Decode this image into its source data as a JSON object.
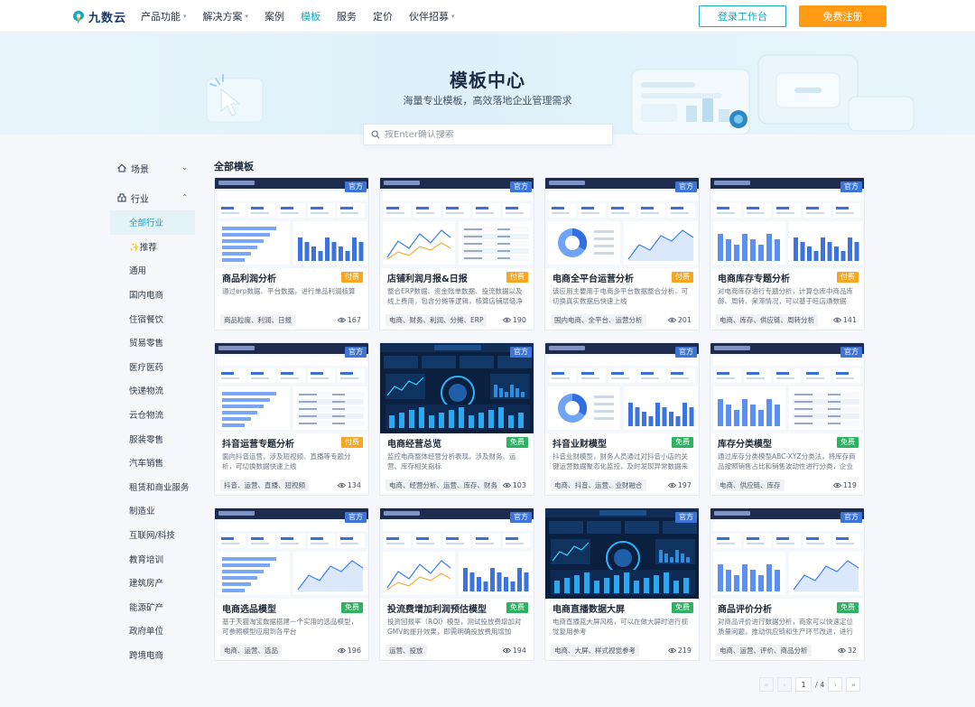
{
  "header": {
    "logo_text": "九数云",
    "nav": [
      {
        "label": "产品功能",
        "dropdown": true,
        "active": false
      },
      {
        "label": "解决方案",
        "dropdown": true,
        "active": false
      },
      {
        "label": "案例",
        "dropdown": false,
        "active": false
      },
      {
        "label": "模板",
        "dropdown": false,
        "active": true
      },
      {
        "label": "服务",
        "dropdown": false,
        "active": false
      },
      {
        "label": "定价",
        "dropdown": false,
        "active": false
      },
      {
        "label": "伙伴招募",
        "dropdown": true,
        "active": false
      }
    ],
    "login_label": "登录工作台",
    "register_label": "免费注册"
  },
  "hero": {
    "title": "模板中心",
    "subtitle": "海量专业模板，高效落地企业管理需求"
  },
  "search": {
    "placeholder": "按Enter确认搜索"
  },
  "sidebar": {
    "groups": [
      {
        "label": "场景",
        "expanded": false
      },
      {
        "label": "行业",
        "expanded": true
      }
    ],
    "items": [
      "全部行业",
      "✨推荐",
      "通用",
      "国内电商",
      "住宿餐饮",
      "贸易零售",
      "医疗医药",
      "快递物流",
      "云仓物流",
      "服装零售",
      "汽车销售",
      "租赁和商业服务",
      "制造业",
      "互联网/科技",
      "教育培训",
      "建筑房产",
      "能源矿产",
      "政府单位",
      "跨境电商"
    ],
    "active_index": 0
  },
  "main": {
    "section_title": "全部模板",
    "official_badge": "官方",
    "cards": [
      {
        "title": "商品利润分析",
        "price": "付费",
        "type": "paid",
        "desc": "通过erp数据、平台数据，进行单品利润核算",
        "tags": "商品粒度、利润、日报",
        "count": "167",
        "theme": "light"
      },
      {
        "title": "店铺利润月报&日报",
        "price": "付费",
        "type": "paid",
        "desc": "整合ERP数据、资金账单数据、投流数据以及线上费用，包含分摊等逻辑，核算店铺层级净利…",
        "tags": "电商、财务、利润、分摊、ERP",
        "count": "190",
        "theme": "light"
      },
      {
        "title": "电商全平台运营分析",
        "price": "付费",
        "type": "paid",
        "desc": "该应用主要用于电商多平台数据整合分析，可切换真实数据后快速上线",
        "tags": "国内电商、全平台、运营分析",
        "count": "201",
        "theme": "light"
      },
      {
        "title": "电商库存专题分析",
        "price": "付费",
        "type": "paid",
        "desc": "对电商库存进行专题分析，计算仓库中商品库龄、周转、呆滞情况，可以基于旺店通数据快…",
        "tags": "电商、库存、供应链、周转分析",
        "count": "141",
        "theme": "light"
      },
      {
        "title": "抖音运营专题分析",
        "price": "付费",
        "type": "paid",
        "desc": "面向抖音运营，涉及短视频、直播等专题分析，可切换数据快速上线",
        "tags": "抖音、运营、直播、短视频",
        "count": "134",
        "theme": "light"
      },
      {
        "title": "电商经营总览",
        "price": "免费",
        "type": "free",
        "desc": "监控电商整体经营分析表现，涉及财务、运营、库存相关指标",
        "tags": "电商、经营分析、运营、库存、财务",
        "count": "103",
        "theme": "dark"
      },
      {
        "title": "抖音业财模型",
        "price": "免费",
        "type": "free",
        "desc": "抖音业财模型，财务人员通过对抖音小店的关键运营数据聚态化监控，及时发现异常数据来有…",
        "tags": "电商、抖音、运营、业财融合",
        "count": "197",
        "theme": "light"
      },
      {
        "title": "库存分类模型",
        "price": "免费",
        "type": "free",
        "desc": "通过库存分类模型ABC-XYZ分类法，将库存商品按照销售占比和销售波动性进行分类，企业可…",
        "tags": "电商、供应链、库存",
        "count": "119",
        "theme": "light"
      },
      {
        "title": "电商选品模型",
        "price": "免费",
        "type": "free",
        "desc": "基于天猫淘宝数据搭建一个实用的选品模型，可参照模型应用到各平台",
        "tags": "电商、运营、选品",
        "count": "196",
        "theme": "light"
      },
      {
        "title": "投流费增加利润预估模型",
        "price": "免费",
        "type": "free",
        "desc": "投资回报率（ROI）模型，测试投放费增加对GMV的提升效果，即需明确投放费用增加后，…",
        "tags": "运营、投放",
        "count": "194",
        "theme": "light"
      },
      {
        "title": "电商直播数据大屏",
        "price": "免费",
        "type": "free",
        "desc": "电商直播蓝大屏风格，可以在做大屏时进行视觉复用参考",
        "tags": "电商、大屏、样式视觉参考",
        "count": "219",
        "theme": "dark"
      },
      {
        "title": "商品评价分析",
        "price": "免费",
        "type": "free",
        "desc": "对商品评价进行数据分析，商家可以快速定位质量问题，推动供应链和生产环节改进，进行产…",
        "tags": "电商、运营、评价、商品分析",
        "count": "32",
        "theme": "light"
      }
    ]
  },
  "pagination": {
    "current": "1",
    "total": "/ 4"
  },
  "colors": {
    "accent": "#1aa3c8",
    "register": "#ff9b14",
    "paid": "#f6a623",
    "free": "#2fb163",
    "official": "#3c74d8"
  }
}
